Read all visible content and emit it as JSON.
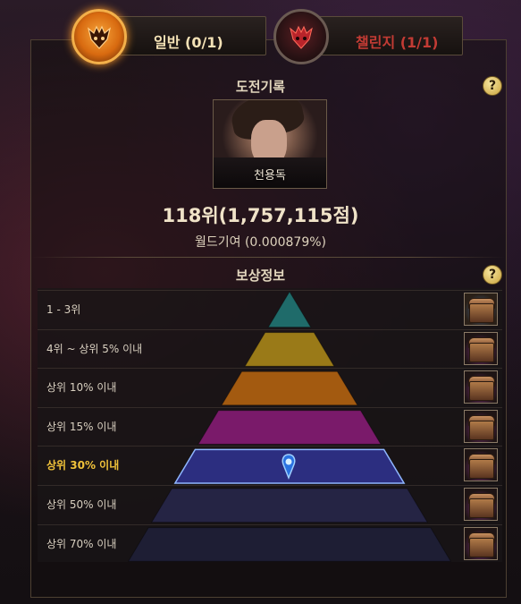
{
  "tabs": {
    "normal": {
      "label": "일반 (0/1)",
      "active": true,
      "color": "#f4e2b6"
    },
    "challenge": {
      "label": "챌린지 (1/1)",
      "active": false,
      "color": "#c23b34"
    }
  },
  "record": {
    "title": "도전기록",
    "character_name": "천용독",
    "rank_text": "118위(1,757,115점)",
    "contribution_text": "월드기여 (0.000879%)"
  },
  "rewards": {
    "title": "보상정보",
    "help_symbol": "?",
    "current_tier_index": 4,
    "current_color": "#f0c23a",
    "tiers": [
      {
        "label": "1 - 3위",
        "color": "#1f6b6a",
        "chest": "gold-chest-icon"
      },
      {
        "label": "4위 ~ 상위 5% 이내",
        "color": "#9a7a18",
        "chest": "chest-icon"
      },
      {
        "label": "상위 10% 이내",
        "color": "#a35a10",
        "chest": "chest-icon"
      },
      {
        "label": "상위 15% 이내",
        "color": "#7a1a6a",
        "chest": "chest-icon"
      },
      {
        "label": "상위 30% 이내",
        "color": "#2c2e80",
        "chest": "chest-icon"
      },
      {
        "label": "상위 50% 이내",
        "color": "#252444",
        "chest": "chest-icon"
      },
      {
        "label": "상위 70% 이내",
        "color": "#1e1e34",
        "chest": "chest-icon"
      }
    ]
  }
}
